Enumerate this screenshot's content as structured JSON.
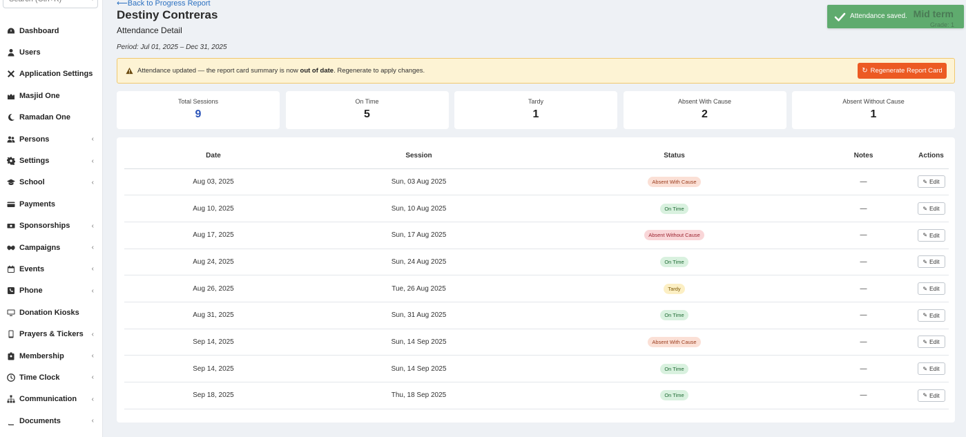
{
  "sidebar": {
    "search_placeholder": "Search (Ctrl+K)",
    "items": [
      {
        "label": "Dashboard",
        "icon": "dashboard-icon",
        "chevron": false
      },
      {
        "label": "Users",
        "icon": "user-icon",
        "chevron": false
      },
      {
        "label": "Application Settings",
        "icon": "tools-icon",
        "chevron": false
      },
      {
        "label": "Masjid One",
        "icon": "mosque-icon",
        "chevron": false
      },
      {
        "label": "Ramadan One",
        "icon": "moon-icon",
        "chevron": false
      },
      {
        "label": "Persons",
        "icon": "people-icon",
        "chevron": true
      },
      {
        "label": "Settings",
        "icon": "gear-icon",
        "chevron": true
      },
      {
        "label": "School",
        "icon": "graduation-cap-icon",
        "chevron": true
      },
      {
        "label": "Payments",
        "icon": "credit-card-icon",
        "chevron": false
      },
      {
        "label": "Sponsorships",
        "icon": "money-bill-icon",
        "chevron": true
      },
      {
        "label": "Campaigns",
        "icon": "handshake-icon",
        "chevron": true
      },
      {
        "label": "Events",
        "icon": "calendar-icon",
        "chevron": true
      },
      {
        "label": "Phone",
        "icon": "phone-icon",
        "chevron": true
      },
      {
        "label": "Donation Kiosks",
        "icon": "monitor-icon",
        "chevron": false
      },
      {
        "label": "Prayers & Tickers",
        "icon": "tablet-icon",
        "chevron": true
      },
      {
        "label": "Membership",
        "icon": "id-badge-icon",
        "chevron": true
      },
      {
        "label": "Time Clock",
        "icon": "clock-icon",
        "chevron": true
      },
      {
        "label": "Communication",
        "icon": "sitemap-icon",
        "chevron": true
      },
      {
        "label": "Documents",
        "icon": "book-icon",
        "chevron": true
      }
    ]
  },
  "header": {
    "back_link": "Back to Progress Report",
    "student_name": "Destiny Contreras",
    "subtitle": "Attendance Detail",
    "period": "Period: Jul 01, 2025 – Dec 31, 2025"
  },
  "alert": {
    "text_before": "Attendance updated — the report card summary is now ",
    "text_bold": "out of date",
    "text_after": ". Regenerate to apply changes.",
    "button_label": "Regenerate Report Card"
  },
  "stats": [
    {
      "label": "Total Sessions",
      "value": "9"
    },
    {
      "label": "On Time",
      "value": "5"
    },
    {
      "label": "Tardy",
      "value": "1"
    },
    {
      "label": "Absent With Cause",
      "value": "2"
    },
    {
      "label": "Absent Without Cause",
      "value": "1"
    }
  ],
  "table": {
    "headers": {
      "date": "Date",
      "session": "Session",
      "status": "Status",
      "notes": "Notes",
      "actions": "Actions"
    },
    "edit_label": "Edit",
    "rows": [
      {
        "date": "Aug 03, 2025",
        "session": "Sun, 03 Aug 2025",
        "status": "Absent With Cause",
        "status_type": "awc",
        "notes": "—"
      },
      {
        "date": "Aug 10, 2025",
        "session": "Sun, 10 Aug 2025",
        "status": "On Time",
        "status_type": "ontime",
        "notes": "—"
      },
      {
        "date": "Aug 17, 2025",
        "session": "Sun, 17 Aug 2025",
        "status": "Absent Without Cause",
        "status_type": "awoc",
        "notes": "—"
      },
      {
        "date": "Aug 24, 2025",
        "session": "Sun, 24 Aug 2025",
        "status": "On Time",
        "status_type": "ontime",
        "notes": "—"
      },
      {
        "date": "Aug 26, 2025",
        "session": "Tue, 26 Aug 2025",
        "status": "Tardy",
        "status_type": "tardy",
        "notes": "—"
      },
      {
        "date": "Aug 31, 2025",
        "session": "Sun, 31 Aug 2025",
        "status": "On Time",
        "status_type": "ontime",
        "notes": "—"
      },
      {
        "date": "Sep 14, 2025",
        "session": "Sun, 14 Sep 2025",
        "status": "Absent With Cause",
        "status_type": "awc",
        "notes": "—"
      },
      {
        "date": "Sep 14, 2025",
        "session": "Sun, 14 Sep 2025",
        "status": "On Time",
        "status_type": "ontime",
        "notes": "—"
      },
      {
        "date": "Sep 18, 2025",
        "session": "Thu, 18 Sep 2025",
        "status": "On Time",
        "status_type": "ontime",
        "notes": "—"
      }
    ]
  },
  "toast": {
    "message": "Attendance saved.",
    "term": "Mid term",
    "grade": "Grade: 1"
  },
  "colors": {
    "accent_orange": "#ec5a23",
    "toast_green": "#5fab6e",
    "link_blue": "#2a6fc0",
    "total_blue": "#2a53b8",
    "alert_bg": "#fdf3d4"
  }
}
